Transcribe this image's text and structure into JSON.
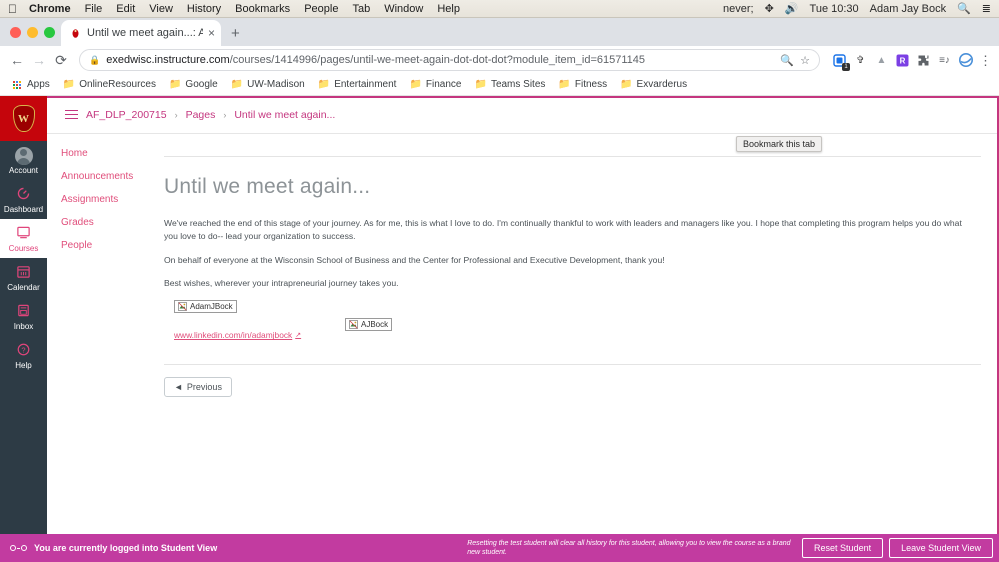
{
  "os_menu": {
    "apple_icon": "apple-icon",
    "items": [
      "Chrome",
      "File",
      "Edit",
      "View",
      "History",
      "Bookmarks",
      "People",
      "Tab",
      "Window",
      "Help"
    ],
    "status_icons": [
      "do-not-disturb-icon",
      "bluetooth-icon",
      "volume-icon"
    ],
    "time": "Tue 10:30",
    "user": "Adam Jay Bock",
    "search_icon": "spotlight-search-icon",
    "control_center_icon": "control-center-icon"
  },
  "browser": {
    "tab": {
      "title": "Until we meet again...: America",
      "favicon": "canvas-favicon",
      "close_label": "×"
    },
    "new_tab_label": "+",
    "back_icon": "back-arrow-icon",
    "forward_icon": "forward-arrow-icon",
    "reload_icon": "reload-icon",
    "lock_icon": "lock-icon",
    "url_host": "exedwisc.instructure.com",
    "url_path": "/courses/1414996/pages/until-we-meet-again-dot-dot-dot?module_item_id=61571145",
    "search_in_page_icon": "magnifier-icon",
    "bookmark_star_icon": "star-icon",
    "extensions": [
      {
        "name": "tab-groups-extension",
        "glyph": "▣",
        "color": "#1a73e8",
        "badge": "1"
      },
      {
        "name": "pocket-extension",
        "glyph": "✇",
        "color": "#444",
        "badge": ""
      },
      {
        "name": "google-drive-extension",
        "glyph": "▲",
        "color": "#9aa0a6",
        "badge": ""
      },
      {
        "name": "grammarly-extension",
        "glyph": "R",
        "color": "#7b3fe4",
        "badge": ""
      },
      {
        "name": "puzzle-extensions-icon",
        "glyph": "✦",
        "color": "#5f6368",
        "badge": ""
      },
      {
        "name": "playlist-extension",
        "glyph": "≡♪",
        "color": "#5f6368",
        "badge": ""
      },
      {
        "name": "profile-avatar",
        "glyph": "◍",
        "color": "#4a90d9",
        "badge": ""
      }
    ],
    "menu_icon": "kebab-menu-icon",
    "tooltip": "Bookmark this tab"
  },
  "bookmarks_bar": {
    "apps_label": "Apps",
    "apps_icon": "apps-grid-icon",
    "folders": [
      "OnlineResources",
      "Google",
      "UW-Madison",
      "Entertainment",
      "Finance",
      "Teams Sites",
      "Fitness",
      "Exvarderus"
    ]
  },
  "global_nav": {
    "logo": "uw-madison-crest-logo",
    "items": [
      {
        "label": "Account",
        "icon": "user-avatar-icon",
        "active": false
      },
      {
        "label": "Dashboard",
        "icon": "dashboard-speedometer-icon",
        "active": false
      },
      {
        "label": "Courses",
        "icon": "courses-book-icon",
        "active": true
      },
      {
        "label": "Calendar",
        "icon": "calendar-icon",
        "active": false
      },
      {
        "label": "Inbox",
        "icon": "inbox-tray-icon",
        "active": false
      },
      {
        "label": "Help",
        "icon": "help-question-icon",
        "active": false
      }
    ]
  },
  "breadcrumb": {
    "menu_icon": "hamburger-menu-icon",
    "items": [
      "AF_DLP_200715",
      "Pages",
      "Until we meet again..."
    ],
    "separator": "›"
  },
  "course_nav": {
    "items": [
      "Home",
      "Announcements",
      "Assignments",
      "Grades",
      "People"
    ]
  },
  "main": {
    "title": "Until we meet again...",
    "paragraphs": [
      "We've reached the end of this stage of your journey. As for me, this is what I love to do. I'm continually thankful to work with leaders and managers like you. I hope that completing this program helps you do what you love to do-- lead your organization to success.",
      "On behalf of everyone at the Wisconsin School of Business and the Center for Professional and Executive Development, thank you!",
      "Best wishes, wherever your intrapreneurial journey takes you."
    ],
    "broken_images": [
      {
        "alt": "AdamJBock",
        "icon": "broken-image-icon"
      },
      {
        "alt": "AJBock",
        "icon": "broken-image-icon"
      }
    ],
    "link": {
      "text": "www.linkedin.com/in/adamjbock",
      "external_icon": "external-link-icon"
    },
    "previous_button": {
      "label": "Previous",
      "arrow": "◄"
    }
  },
  "student_view_bar": {
    "icon": "glasses-icon",
    "status_text": "You are currently logged into Student View",
    "description": "Resetting the test student will clear all history for this student, allowing you to view the course as a brand new student.",
    "reset_button": "Reset Student",
    "leave_button": "Leave Student View",
    "background_color": "#c23ba0"
  },
  "colors": {
    "canvas_accent": "#e04e7b",
    "uw_red": "#c5050c",
    "page_border": "#c4367f",
    "global_nav_bg": "#2d3b45"
  }
}
